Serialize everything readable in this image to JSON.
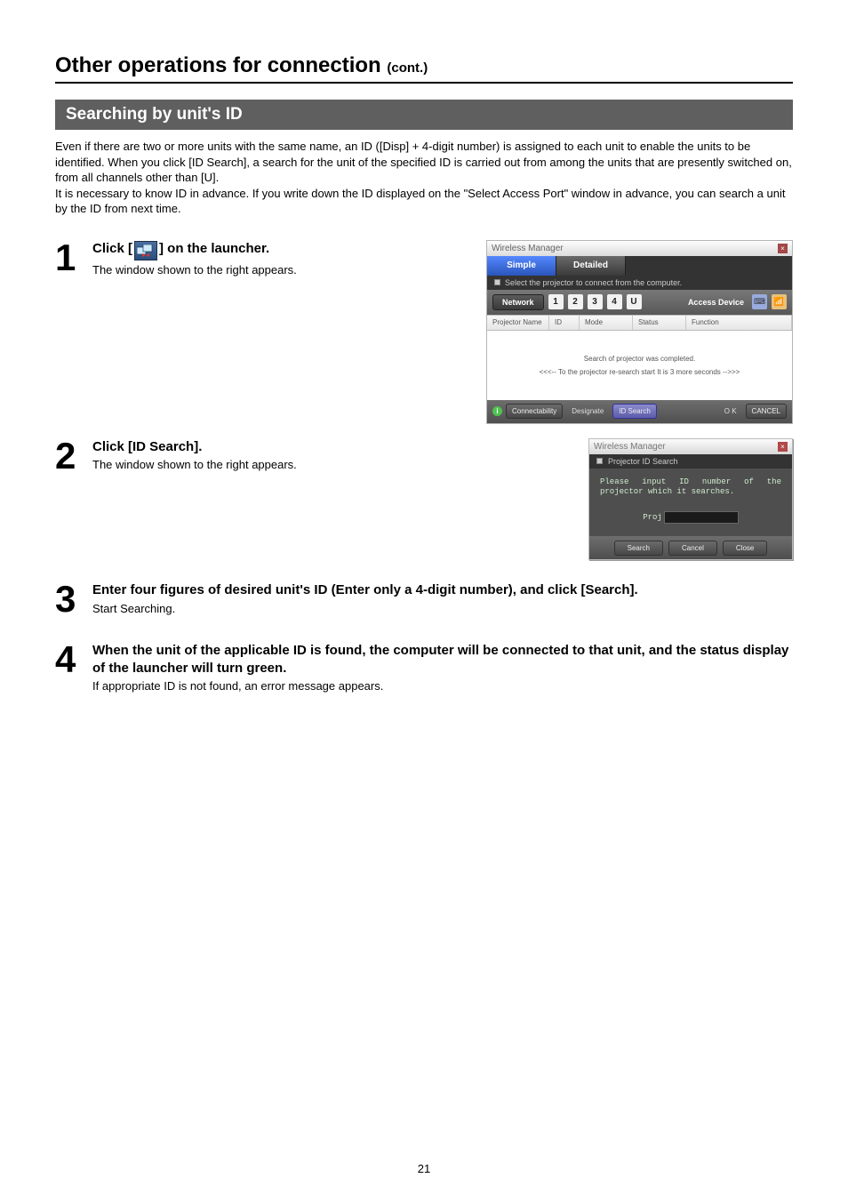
{
  "page": {
    "title": "Other operations for connection",
    "title_cont": "(cont.)",
    "number": "21"
  },
  "section": {
    "heading": "Searching by unit's ID",
    "intro": "Even if there are two or more units with the same name, an ID ([Disp] + 4-digit number) is assigned to each unit to enable the units to be identified. When you click [ID Search], a search for the unit of the specified ID is carried out from among the units that are presently switched on, from all channels other than [U].\nIt is necessary to know ID in advance. If you write down the ID displayed on the \"Select Access Port\" window in advance, you can search a unit by the ID from next time."
  },
  "steps": [
    {
      "num": "1",
      "heading_pre": "Click [",
      "heading_post": "] on the launcher.",
      "desc": "The window shown to the right appears."
    },
    {
      "num": "2",
      "heading": "Click [ID Search].",
      "desc": "The window shown to the right appears."
    },
    {
      "num": "3",
      "heading": "Enter four figures of desired unit's ID (Enter only a 4-digit number), and click [Search].",
      "desc": "Start Searching."
    },
    {
      "num": "4",
      "heading": "When the unit of the applicable ID is found, the computer will be connected to that unit, and the status display of the launcher will turn green.",
      "desc": "If appropriate ID is not found, an error message appears."
    }
  ],
  "wm": {
    "title": "Wireless Manager",
    "tabs": {
      "simple": "Simple",
      "detailed": "Detailed"
    },
    "instruction": "Select the projector to connect from the computer.",
    "toolbar": {
      "network": "Network",
      "nums": [
        "1",
        "2",
        "3",
        "4",
        "U"
      ],
      "access_device": "Access Device"
    },
    "columns": {
      "name": "Projector Name",
      "id": "ID",
      "mode": "Mode",
      "status": "Status",
      "function": "Function"
    },
    "body": {
      "line1": "Search of projector was completed.",
      "line2": "<<<--  To the projector re-search start It is 3 more seconds  -->>>"
    },
    "footer": {
      "connectability": "Connectability",
      "designate": "Designate",
      "id_search": "ID Search",
      "ok": "O K",
      "cancel": "CANCEL"
    }
  },
  "id_dialog": {
    "title": "Wireless Manager",
    "subtitle": "Projector ID Search",
    "message": "Please input ID number of the projector which it searches.",
    "input_label": "Proj",
    "buttons": {
      "search": "Search",
      "cancel": "Cancel",
      "close": "Close"
    }
  }
}
